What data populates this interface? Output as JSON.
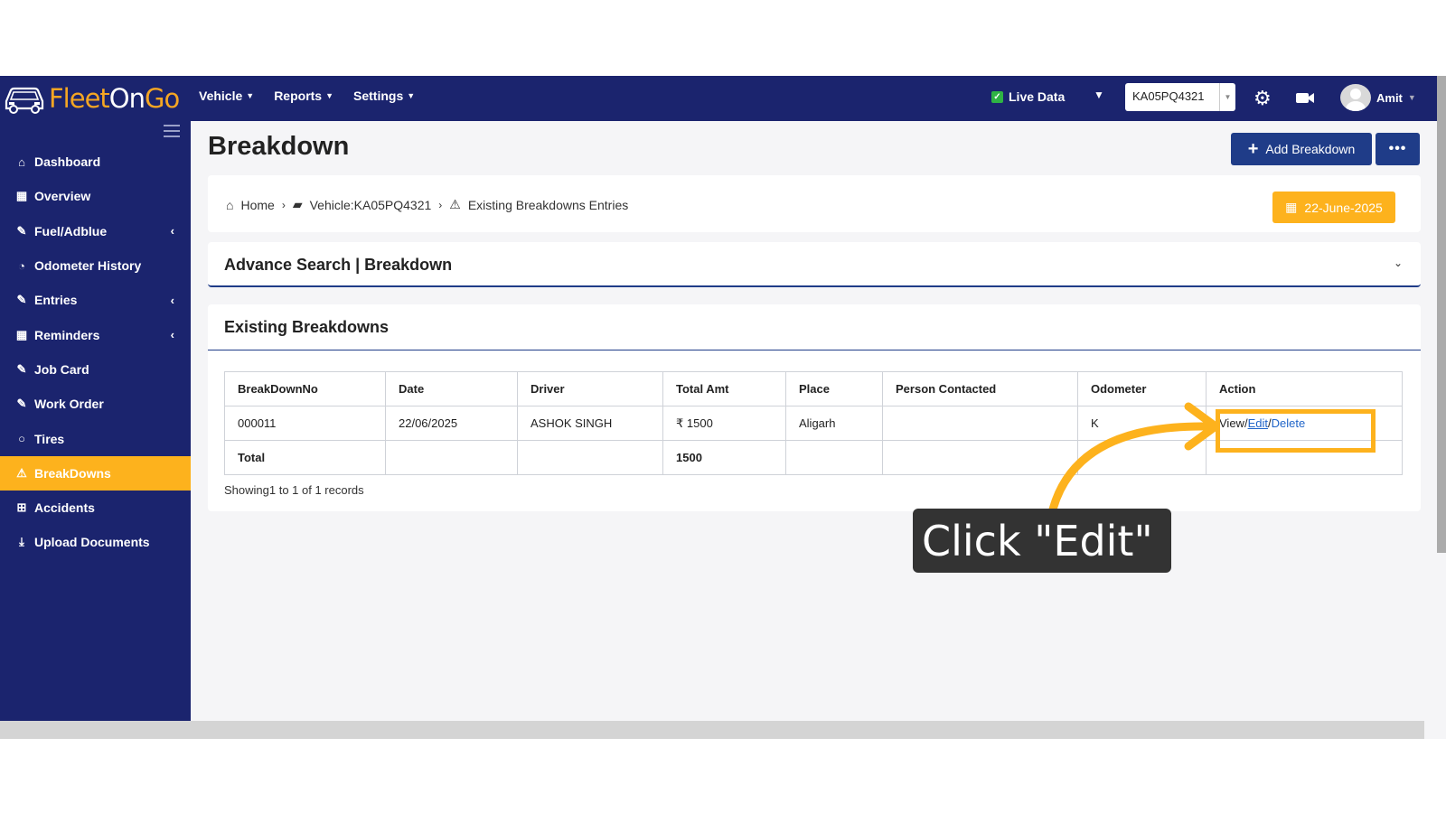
{
  "topbar": {
    "brand": {
      "part1": "Fleet",
      "part2": "On",
      "part3": "Go"
    },
    "menus": [
      {
        "label": "Vehicle"
      },
      {
        "label": "Reports"
      },
      {
        "label": "Settings"
      }
    ],
    "live_data_label": "Live Data",
    "vehicle_select_value": "KA05PQ4321",
    "user_name": "Amit"
  },
  "sidebar": {
    "items": [
      {
        "label": "Dashboard",
        "icon": "home-icon",
        "has_chevron": false,
        "active": false
      },
      {
        "label": "Overview",
        "icon": "overview-icon",
        "has_chevron": false,
        "active": false
      },
      {
        "label": "Fuel/Adblue",
        "icon": "edit-icon",
        "has_chevron": true,
        "active": false
      },
      {
        "label": "Odometer History",
        "icon": "dashboard-gauge-icon",
        "has_chevron": false,
        "active": false
      },
      {
        "label": "Entries",
        "icon": "edit-icon",
        "has_chevron": true,
        "active": false
      },
      {
        "label": "Reminders",
        "icon": "calendar-icon",
        "has_chevron": true,
        "active": false
      },
      {
        "label": "Job Card",
        "icon": "edit-icon",
        "has_chevron": false,
        "active": false
      },
      {
        "label": "Work Order",
        "icon": "edit-icon",
        "has_chevron": false,
        "active": false
      },
      {
        "label": "Tires",
        "icon": "tire-icon",
        "has_chevron": false,
        "active": false
      },
      {
        "label": "BreakDowns",
        "icon": "warning-icon",
        "has_chevron": false,
        "active": true
      },
      {
        "label": "Accidents",
        "icon": "plus-square-icon",
        "has_chevron": false,
        "active": false
      },
      {
        "label": "Upload Documents",
        "icon": "download-icon",
        "has_chevron": false,
        "active": false
      }
    ]
  },
  "page": {
    "title": "Breakdown",
    "add_button_label": "Add Breakdown",
    "more_button_label": "•••",
    "breadcrumb": {
      "home": "Home",
      "vehicle": "Vehicle:KA05PQ4321",
      "current": "Existing Breakdowns Entries"
    },
    "date_badge": "22-June-2025",
    "advance_search_title": "Advance Search | Breakdown",
    "list_title": "Existing Breakdowns",
    "table": {
      "headers": [
        "BreakDownNo",
        "Date",
        "Driver",
        "Total Amt",
        "Place",
        "Person Contacted",
        "Odometer",
        "Action"
      ],
      "rows": [
        {
          "no": "000011",
          "date": "22/06/2025",
          "driver": "ASHOK SINGH",
          "amount": "₹ 1500",
          "place": "Aligarh",
          "person": "",
          "odometer": "K",
          "view": "View",
          "edit": "Edit",
          "delete": "Delete"
        }
      ],
      "total_label": "Total",
      "total_amount": "1500"
    },
    "showing_text": "Showing1 to 1 of 1 records"
  },
  "annotation": {
    "text": "Click \"Edit\"",
    "color": "#fdb21d"
  },
  "colors": {
    "navy": "#1b246e",
    "accent": "#fdb21d",
    "button": "#1f3c88"
  }
}
